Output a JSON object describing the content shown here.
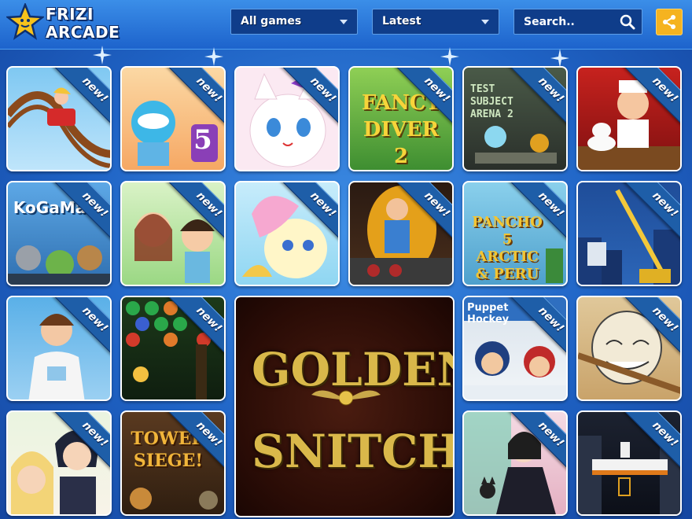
{
  "header": {
    "logo_line1": "FRIZI",
    "logo_line2": "ARCADE",
    "filter_label": "All games",
    "sort_label": "Latest",
    "search_placeholder": "Search..",
    "icons": [
      "star-logo-icon",
      "chevron-down-icon",
      "search-icon",
      "share-icon"
    ]
  },
  "badge": "new!",
  "colors": {
    "accent": "#f5b320",
    "header": "#2a78da",
    "ribbon": "#1e5ea8",
    "background": "#2466c8"
  },
  "tiles": [
    {
      "name": "rollercoaster",
      "text": ""
    },
    {
      "name": "ski-five",
      "text": "5"
    },
    {
      "name": "kitten",
      "text": ""
    },
    {
      "name": "fancy-diver-2",
      "text": "FANCY DIVER 2"
    },
    {
      "name": "test-subject-arena-2",
      "text": "TEST SUBJECT ARENA 2"
    },
    {
      "name": "chef-cake",
      "text": ""
    },
    {
      "name": "kogama",
      "text": "KoGaMa"
    },
    {
      "name": "kids-in-love",
      "text": ""
    },
    {
      "name": "pony",
      "text": ""
    },
    {
      "name": "cooking-lady",
      "text": ""
    },
    {
      "name": "pancho-5",
      "text": "PANCHO 5 ARCTIC & PERU"
    },
    {
      "name": "crane-city",
      "text": ""
    },
    {
      "name": "boy-dressup",
      "text": ""
    },
    {
      "name": "bubble-forest",
      "text": ""
    },
    {
      "name": "golden-snitch",
      "text": "GOLDEN SNITCH"
    },
    {
      "name": "puppet-hockey",
      "text": "Puppet Hockey"
    },
    {
      "name": "troll-face",
      "text": ""
    },
    {
      "name": "anime-couple",
      "text": ""
    },
    {
      "name": "tower-siege",
      "text": "TOWER SIEGE!"
    },
    {
      "name": "witch-girl-cat",
      "text": ""
    },
    {
      "name": "dark-platformer",
      "text": ""
    }
  ]
}
